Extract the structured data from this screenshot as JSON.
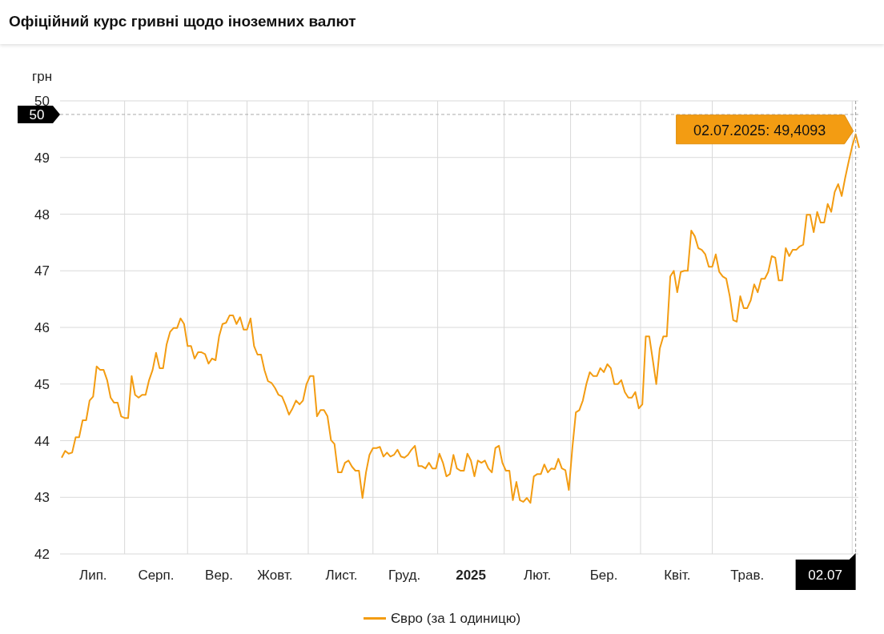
{
  "header": {
    "title": "Офіційний курс гривні щодо іноземних валют"
  },
  "chart": {
    "chart_data": {
      "type": "line",
      "ylabel": "грн",
      "ylim": [
        42,
        50
      ],
      "yticks": [
        42,
        43,
        44,
        45,
        46,
        47,
        48,
        49,
        50
      ],
      "categories": [
        null,
        null,
        null,
        null,
        null,
        null,
        null,
        null,
        null,
        "Лип.",
        null,
        null,
        null,
        null,
        null,
        null,
        null,
        null,
        null,
        null,
        null,
        null,
        null,
        null,
        null,
        null,
        null,
        "Серп.",
        null,
        null,
        null,
        null,
        null,
        null,
        null,
        null,
        null,
        null,
        null,
        null,
        null,
        null,
        null,
        null,
        null,
        "Вер.",
        null,
        null,
        null,
        null,
        null,
        null,
        null,
        null,
        null,
        null,
        null,
        null,
        null,
        null,
        null,
        "Жовт.",
        null,
        null,
        null,
        null,
        null,
        null,
        null,
        null,
        null,
        null,
        null,
        null,
        null,
        null,
        null,
        null,
        null,
        null,
        "Лист.",
        null,
        null,
        null,
        null,
        null,
        null,
        null,
        null,
        null,
        null,
        null,
        null,
        null,
        null,
        null,
        null,
        null,
        "Груд.",
        null,
        null,
        null,
        null,
        null,
        null,
        null,
        null,
        null,
        null,
        null,
        null,
        null,
        null,
        null,
        null,
        null,
        null,
        "**2025**",
        null,
        null,
        null,
        null,
        null,
        null,
        null,
        null,
        null,
        null,
        null,
        null,
        null,
        null,
        null,
        null,
        null,
        null,
        "Лют.",
        null,
        null,
        null,
        null,
        null,
        null,
        null,
        null,
        null,
        null,
        null,
        null,
        null,
        null,
        null,
        null,
        null,
        null,
        "Бер.",
        null,
        null,
        null,
        null,
        null,
        null,
        null,
        null,
        null,
        null,
        null,
        null,
        null,
        null,
        null,
        null,
        null,
        null,
        null,
        null,
        "Квіт.",
        null,
        null,
        null,
        null,
        null,
        null,
        null,
        null,
        null,
        null,
        null,
        null,
        null,
        null,
        null,
        null,
        null,
        null,
        null,
        "Трав.",
        null,
        null,
        null,
        null,
        null,
        null,
        null,
        null,
        null,
        null,
        null,
        null,
        null,
        null,
        null,
        null,
        null,
        null,
        null,
        null,
        null,
        null,
        null,
        null,
        null,
        null,
        null,
        null,
        null,
        null,
        null,
        null
      ],
      "series": [
        {
          "name": "Євро (за 1 одиницю)",
          "color": "#f39c12",
          "values": [
            43.7,
            43.82,
            43.77,
            43.79,
            44.06,
            44.06,
            44.36,
            44.36,
            44.71,
            44.78,
            45.31,
            45.25,
            45.25,
            45.07,
            44.76,
            44.67,
            44.67,
            44.43,
            44.4,
            44.4,
            45.14,
            44.81,
            44.76,
            44.81,
            44.81,
            45.07,
            45.25,
            45.55,
            45.28,
            45.28,
            45.7,
            45.92,
            45.99,
            45.99,
            46.16,
            46.06,
            45.67,
            45.67,
            45.45,
            45.56,
            45.56,
            45.53,
            45.36,
            45.45,
            45.42,
            45.84,
            46.06,
            46.08,
            46.21,
            46.21,
            46.06,
            46.18,
            45.96,
            45.96,
            46.16,
            45.67,
            45.52,
            45.52,
            45.24,
            45.05,
            45.02,
            44.93,
            44.81,
            44.78,
            44.63,
            44.46,
            44.57,
            44.71,
            44.64,
            44.71,
            45.0,
            45.14,
            45.14,
            44.43,
            44.54,
            44.54,
            44.43,
            44.01,
            43.94,
            43.44,
            43.44,
            43.61,
            43.65,
            43.54,
            43.47,
            43.47,
            42.99,
            43.44,
            43.75,
            43.87,
            43.87,
            43.89,
            43.72,
            43.79,
            43.72,
            43.75,
            43.84,
            43.72,
            43.7,
            43.75,
            43.84,
            43.91,
            43.55,
            43.55,
            43.51,
            43.61,
            43.51,
            43.51,
            43.77,
            43.61,
            43.37,
            43.41,
            43.75,
            43.51,
            43.47,
            43.47,
            43.77,
            43.65,
            43.37,
            43.65,
            43.61,
            43.65,
            43.51,
            43.44,
            43.87,
            43.91,
            43.61,
            43.47,
            43.47,
            42.95,
            43.27,
            42.95,
            42.92,
            42.99,
            42.9,
            43.37,
            43.41,
            43.41,
            43.58,
            43.44,
            43.51,
            43.5,
            43.68,
            43.51,
            43.48,
            43.13,
            43.87,
            44.5,
            44.54,
            44.71,
            45.0,
            45.21,
            45.14,
            45.14,
            45.28,
            45.21,
            45.35,
            45.28,
            45.0,
            45.0,
            45.07,
            44.86,
            44.76,
            44.76,
            44.86,
            44.57,
            44.64,
            45.84,
            45.84,
            45.42,
            45.0,
            45.63,
            45.84,
            45.84,
            46.9,
            47.0,
            46.62,
            46.98,
            47.0,
            47.0,
            47.71,
            47.61,
            47.4,
            47.37,
            47.29,
            47.07,
            47.07,
            47.29,
            46.98,
            46.9,
            46.86,
            46.55,
            46.13,
            46.1,
            46.55,
            46.34,
            46.34,
            46.48,
            46.76,
            46.62,
            46.86,
            46.86,
            46.98,
            47.26,
            47.23,
            46.83,
            46.83,
            47.4,
            47.26,
            47.37,
            47.37,
            47.43,
            47.46,
            47.99,
            47.99,
            47.68,
            48.04,
            47.85,
            47.85,
            48.18,
            48.04,
            48.39,
            48.53,
            48.32,
            48.64,
            48.93,
            49.2,
            49.41,
            49.17
          ]
        }
      ],
      "grid": true,
      "ref_lines": [
        {
          "axis": "y",
          "value": 49.76
        }
      ]
    },
    "tooltip": {
      "text": "02.07.2025: 49,4093"
    },
    "crosshair": {
      "date_label": "02.07",
      "value_label": "50"
    }
  }
}
